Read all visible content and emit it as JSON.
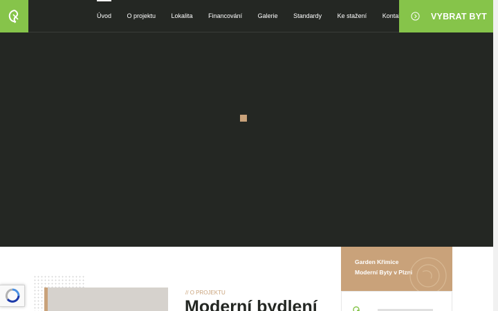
{
  "header": {
    "nav": [
      {
        "label": "Úvod",
        "active": true
      },
      {
        "label": "O projektu",
        "active": false
      },
      {
        "label": "Lokalita",
        "active": false
      },
      {
        "label": "Financování",
        "active": false
      },
      {
        "label": "Galerie",
        "active": false
      },
      {
        "label": "Standardy",
        "active": false
      },
      {
        "label": "Ke stažení",
        "active": false
      },
      {
        "label": "Kontakt",
        "active": false
      }
    ],
    "cta_label": "VYBRAT BYT",
    "cta_icon": "arrow-circle-right-icon",
    "logo_icon": "leaf-logo-icon"
  },
  "section": {
    "eyebrow_prefix": "//",
    "eyebrow": "O PROJEKTU",
    "heading": "Moderní bydlení"
  },
  "card": {
    "line1": "Garden Křimice",
    "line2": "Moderní Byty v Plzni"
  },
  "colors": {
    "dark": "#242723",
    "green": "#86c44a",
    "tan": "#c9a27a",
    "white": "#ffffff"
  }
}
